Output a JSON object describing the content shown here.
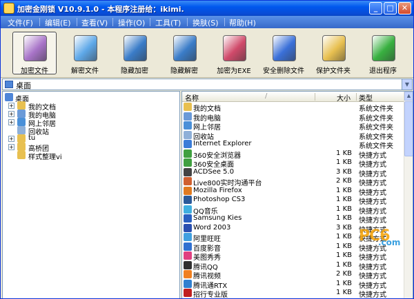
{
  "window": {
    "title": "加密金刚锁 V10.9.1.0 - 本程序注册给：ikimi.",
    "minimize": "_",
    "maximize": "□",
    "close": "✕"
  },
  "menu": [
    "文件(F)",
    "编辑(E)",
    "查看(V)",
    "操作(O)",
    "工具(T)",
    "换肤(S)",
    "帮助(H)"
  ],
  "toolbar": [
    {
      "label": "加密文件",
      "icon": "encrypt-file-icon",
      "color": "#a874c8",
      "active": true
    },
    {
      "label": "解密文件",
      "icon": "decrypt-file-icon",
      "color": "#5ea8e8",
      "active": false
    },
    {
      "label": "隐藏加密",
      "icon": "hide-encrypt-icon",
      "color": "#3a7cc8",
      "active": false
    },
    {
      "label": "隐藏解密",
      "icon": "hide-decrypt-icon",
      "color": "#3a7cc8",
      "active": false
    },
    {
      "label": "加密为EXE",
      "icon": "encrypt-exe-icon",
      "color": "#d04a6a",
      "active": false
    },
    {
      "label": "安全删除文件",
      "icon": "secure-delete-icon",
      "color": "#3a70d8",
      "active": false
    },
    {
      "label": "保护文件夹",
      "icon": "protect-folder-icon",
      "color": "#e8c050",
      "active": false
    },
    {
      "label": "退出程序",
      "icon": "exit-icon",
      "color": "#38b040",
      "active": false
    }
  ],
  "address": {
    "value": "桌面",
    "dropdown": "▼"
  },
  "tree": {
    "root": "桌面",
    "items": [
      {
        "label": "我的文档",
        "expand": "+",
        "color": "#e8c050"
      },
      {
        "label": "我的电脑",
        "expand": "+",
        "color": "#6a9ad8"
      },
      {
        "label": "网上邻居",
        "expand": "+",
        "color": "#4a90d8"
      },
      {
        "label": "回收站",
        "expand": "",
        "color": "#8fb0d8"
      },
      {
        "label": "tu",
        "expand": "+",
        "color": "#e8c050"
      },
      {
        "label": "高桥团",
        "expand": "+",
        "color": "#e8c050"
      },
      {
        "label": "样式整理vi",
        "expand": "",
        "color": "#e8c050"
      }
    ]
  },
  "list": {
    "headers": {
      "name": "名称",
      "sort": "/",
      "size": "大小",
      "type": "类型"
    },
    "rows": [
      {
        "name": "我的文档",
        "size": "",
        "type": "系统文件夹",
        "color": "#e8c050"
      },
      {
        "name": "我的电脑",
        "size": "",
        "type": "系统文件夹",
        "color": "#6a9ad8"
      },
      {
        "name": "网上邻居",
        "size": "",
        "type": "系统文件夹",
        "color": "#4a90d8"
      },
      {
        "name": "回收站",
        "size": "",
        "type": "系统文件夹",
        "color": "#8fb0d8"
      },
      {
        "name": "Internet Explorer",
        "size": "",
        "type": "系统文件夹",
        "color": "#3a7cd8"
      },
      {
        "name": "360安全浏览器",
        "size": "1 KB",
        "type": "快捷方式",
        "color": "#40a040"
      },
      {
        "name": "360安全桌面",
        "size": "1 KB",
        "type": "快捷方式",
        "color": "#40a040"
      },
      {
        "name": "ACDSee 5.0",
        "size": "3 KB",
        "type": "快捷方式",
        "color": "#444444"
      },
      {
        "name": "Live800实时沟通平台",
        "size": "2 KB",
        "type": "快捷方式",
        "color": "#d06030"
      },
      {
        "name": "Mozilla Firefox",
        "size": "1 KB",
        "type": "快捷方式",
        "color": "#e07a20"
      },
      {
        "name": "Photoshop CS3",
        "size": "1 KB",
        "type": "快捷方式",
        "color": "#2a5a9a"
      },
      {
        "name": "QQ音乐",
        "size": "1 KB",
        "type": "快捷方式",
        "color": "#40b0e0"
      },
      {
        "name": "Samsung Kies",
        "size": "1 KB",
        "type": "快捷方式",
        "color": "#2a60c0"
      },
      {
        "name": "Word 2003",
        "size": "3 KB",
        "type": "快捷方式",
        "color": "#2a50b0"
      },
      {
        "name": "阿里旺旺",
        "size": "1 KB",
        "type": "快捷方式",
        "color": "#40a0e0"
      },
      {
        "name": "百度影音",
        "size": "1 KB",
        "type": "快捷方式",
        "color": "#3070d0"
      },
      {
        "name": "美图秀秀",
        "size": "1 KB",
        "type": "快捷方式",
        "color": "#e04080"
      },
      {
        "name": "腾讯QQ",
        "size": "1 KB",
        "type": "快捷方式",
        "color": "#303030"
      },
      {
        "name": "腾讯视频",
        "size": "2 KB",
        "type": "快捷方式",
        "color": "#f08020"
      },
      {
        "name": "腾讯通RTX",
        "size": "1 KB",
        "type": "快捷方式",
        "color": "#3080d0"
      },
      {
        "name": "招行专业版",
        "size": "1 KB",
        "type": "快捷方式",
        "color": "#c02020"
      }
    ]
  },
  "watermark": {
    "main": "PC6",
    "sub": ".com"
  }
}
